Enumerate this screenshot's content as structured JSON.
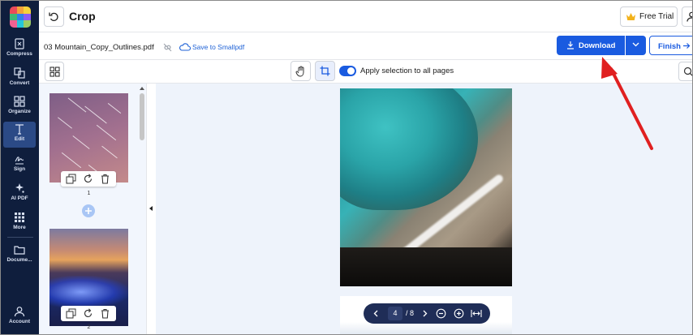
{
  "nav": {
    "items": [
      {
        "label": "Compress",
        "icon": "compress-icon"
      },
      {
        "label": "Convert",
        "icon": "convert-icon"
      },
      {
        "label": "Organize",
        "icon": "organize-icon"
      },
      {
        "label": "Edit",
        "icon": "edit-icon",
        "active": true
      },
      {
        "label": "Sign",
        "icon": "sign-icon"
      },
      {
        "label": "AI PDF",
        "icon": "ai-sparkle-icon"
      },
      {
        "label": "More",
        "icon": "more-grid-icon"
      },
      {
        "label": "Docume...",
        "icon": "folder-icon"
      },
      {
        "label": "Account",
        "icon": "account-icon"
      }
    ]
  },
  "header": {
    "title": "Crop",
    "free_trial_label": "Free Trial"
  },
  "file": {
    "name": "03 Mountain_Copy_Outlines.pdf",
    "save_label": "Save to Smallpdf"
  },
  "actions": {
    "download_label": "Download",
    "finish_label": "Finish"
  },
  "toolbar": {
    "apply_all_label": "Apply selection to all pages",
    "apply_all_enabled": true
  },
  "thumbnails": [
    {
      "number": "1"
    },
    {
      "number": "2"
    }
  ],
  "pager": {
    "current": "4",
    "total": "/ 8"
  },
  "colors": {
    "accent": "#1a5be0",
    "nav_bg": "#0f1e3d",
    "canvas_bg": "#eef3fb",
    "annotation_arrow": "#e02020"
  }
}
